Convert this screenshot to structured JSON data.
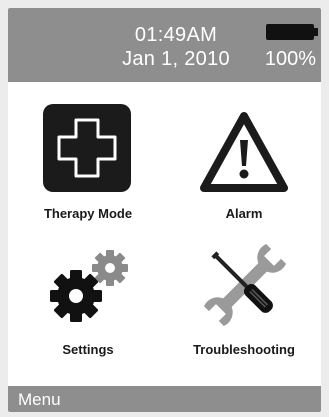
{
  "status_bar": {
    "time": "01:49AM",
    "date": "Jan 1, 2010",
    "battery_percent": "100%",
    "battery_level": 1.0
  },
  "tiles": [
    {
      "label": "Therapy Mode",
      "icon": "medical-cross-icon"
    },
    {
      "label": "Alarm",
      "icon": "warning-triangle-icon"
    },
    {
      "label": "Settings",
      "icon": "gears-icon"
    },
    {
      "label": "Troubleshooting",
      "icon": "tools-icon"
    }
  ],
  "menu_bar": {
    "label": "Menu"
  }
}
